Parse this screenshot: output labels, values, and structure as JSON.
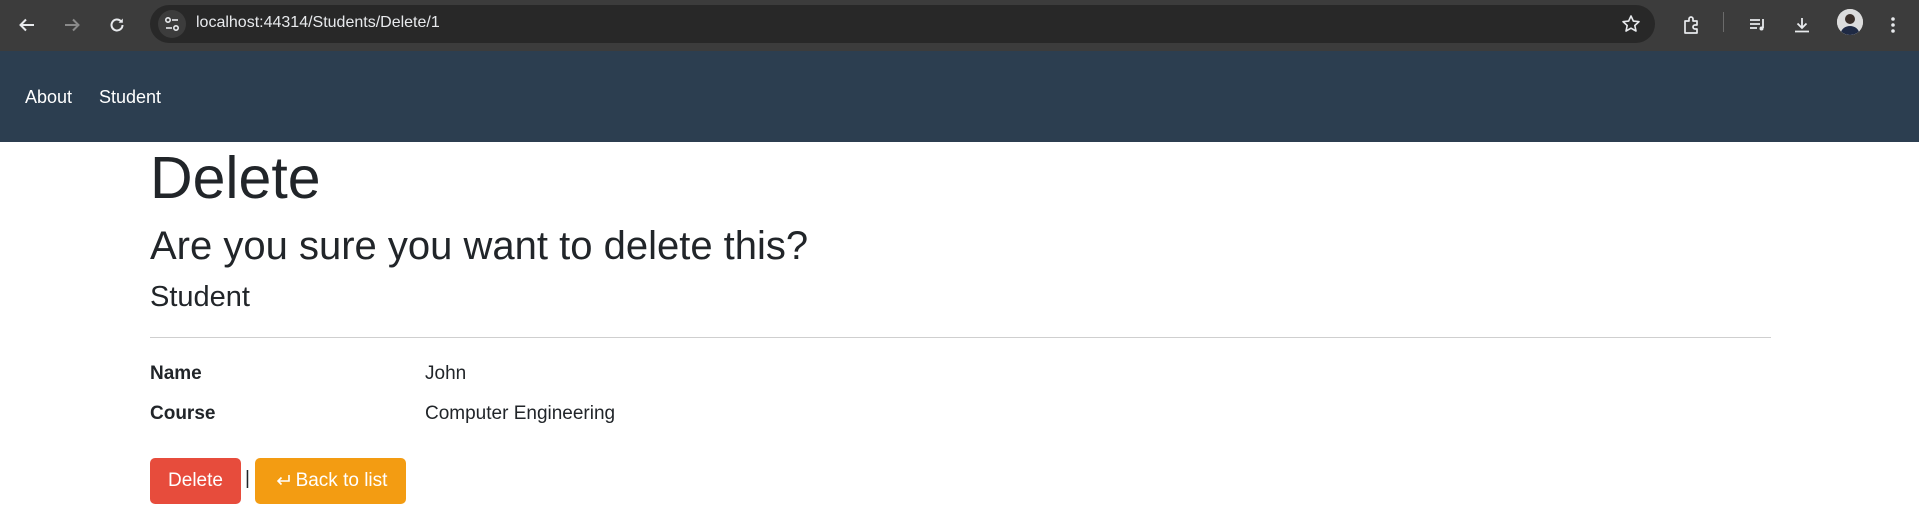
{
  "browser": {
    "url": "localhost:44314/Students/Delete/1"
  },
  "navbar": {
    "links": [
      {
        "label": "About"
      },
      {
        "label": "Student"
      }
    ]
  },
  "page": {
    "title": "Delete",
    "question": "Are you sure you want to delete this?",
    "entity": "Student"
  },
  "details": [
    {
      "label": "Name",
      "value": "John"
    },
    {
      "label": "Course",
      "value": "Computer Engineering"
    }
  ],
  "actions": {
    "delete_label": "Delete",
    "separator": "|",
    "back_label": "Back to list"
  },
  "colors": {
    "navbar": "#2c3e50",
    "danger": "#e74c3c",
    "warning": "#f39c12"
  }
}
